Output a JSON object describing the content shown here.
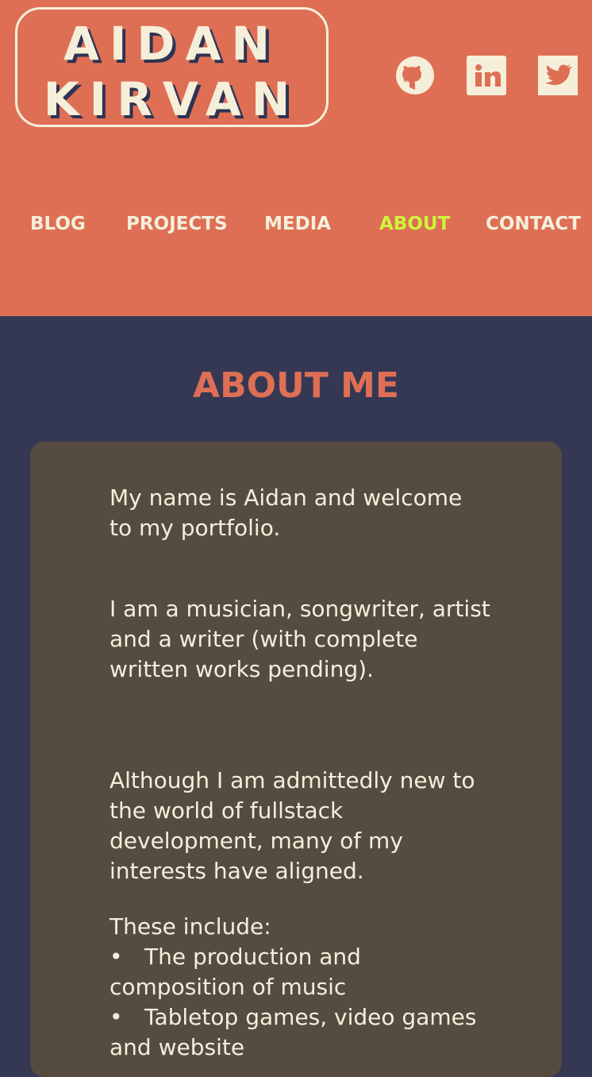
{
  "header": {
    "logo_line1": "AIDAN",
    "logo_line2": "KIRVAN",
    "social": [
      {
        "name": "github-icon"
      },
      {
        "name": "linkedin-icon"
      },
      {
        "name": "twitter-icon"
      }
    ]
  },
  "nav": {
    "items": [
      {
        "label": "BLOG"
      },
      {
        "label": "PROJECTS"
      },
      {
        "label": "MEDIA"
      },
      {
        "label": "ABOUT",
        "active": true
      },
      {
        "label": "CONTACT"
      }
    ]
  },
  "about": {
    "title": "ABOUT ME",
    "p1": "My name is Aidan and welcome to my portfolio.",
    "p2": "I am a musician, songwriter, artist and a writer (with complete written works pending).",
    "p3": "Although I am admittedly new to the world of fullstack development, many of my interests have aligned.",
    "p4": "These include:",
    "bullets": [
      "The production and composition of music",
      "Tabletop games, video games and website"
    ]
  },
  "colors": {
    "header_bg": "#DE6F55",
    "page_bg": "#343853",
    "card_bg": "#554B41",
    "text": "#F5EFDA",
    "active_nav": "#CFF43A"
  }
}
